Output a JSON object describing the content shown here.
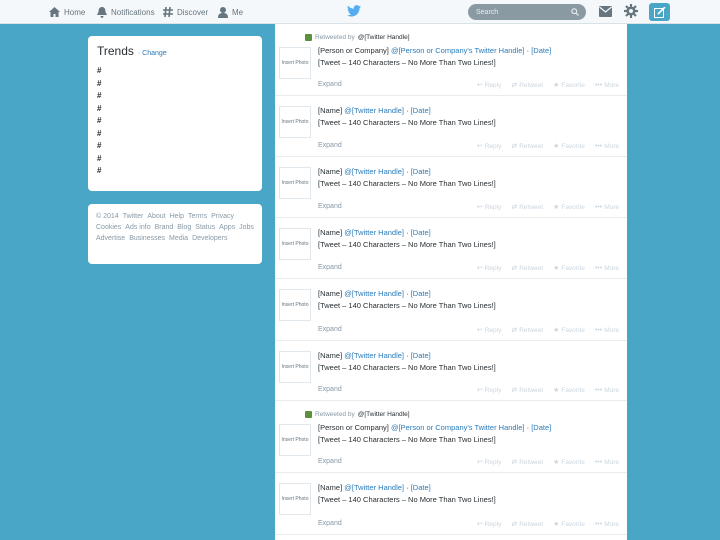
{
  "nav": {
    "home": "Home",
    "notifications": "Notifications",
    "discover": "Discover",
    "me": "Me",
    "search_placeholder": "Search"
  },
  "trends": {
    "title": "Trends",
    "change": "· Change",
    "items": [
      "#",
      "#",
      "#",
      "#",
      "#",
      "#",
      "#",
      "#",
      "#"
    ]
  },
  "footer": {
    "links": [
      "© 2014",
      "Twitter",
      "About",
      "Help",
      "Terms",
      "Privacy",
      "Cookies",
      "Ads info",
      "Brand",
      "Blog",
      "Status",
      "Apps",
      "Jobs",
      "Advertise",
      "Businesses",
      "Media",
      "Developers"
    ]
  },
  "tweet_labels": {
    "retweeted_by": "Retweeted by",
    "expand": "Expand",
    "reply": "Reply",
    "retweet": "Retweet",
    "favorite": "Favorite",
    "more": "More",
    "avatar": "Insert Photo"
  },
  "tweets": [
    {
      "retweet": true,
      "rt_handle": "@[Twitter Handle]",
      "name": "[Person or Company]",
      "handle": "@[Person or Company's Twitter Handle]",
      "sep": "·",
      "date": "[Date]",
      "text": "[Tweet – 140 Characters – No More Than Two Lines!]"
    },
    {
      "retweet": false,
      "rt_handle": "",
      "name": "[Name]",
      "handle": "@[Twitter Handle]",
      "sep": "·",
      "date": "[Date]",
      "text": "[Tweet – 140 Characters – No More Than Two Lines!]"
    },
    {
      "retweet": false,
      "rt_handle": "",
      "name": "[Name]",
      "handle": "@[Twitter Handle]",
      "sep": "·",
      "date": "[Date]",
      "text": "[Tweet – 140 Characters – No More Than Two Lines!]"
    },
    {
      "retweet": false,
      "rt_handle": "",
      "name": "[Name]",
      "handle": "@[Twitter Handle]",
      "sep": "·",
      "date": "[Date]",
      "text": "[Tweet – 140 Characters – No More Than Two Lines!]"
    },
    {
      "retweet": false,
      "rt_handle": "",
      "name": "[Name]",
      "handle": "@[Twitter Handle]",
      "sep": "·",
      "date": "[Date]",
      "text": "[Tweet – 140 Characters – No More Than Two Lines!]"
    },
    {
      "retweet": false,
      "rt_handle": "",
      "name": "[Name]",
      "handle": "@[Twitter Handle]",
      "sep": "·",
      "date": "[Date]",
      "text": "[Tweet – 140 Characters – No More Than Two Lines!]"
    },
    {
      "retweet": true,
      "rt_handle": "@[Twitter Handle]",
      "name": "[Person or Company]",
      "handle": "@[Person or Company's Twitter Handle]",
      "sep": "·",
      "date": "[Date]",
      "text": "[Tweet – 140 Characters – No More Than Two Lines!]"
    },
    {
      "retweet": false,
      "rt_handle": "",
      "name": "[Name]",
      "handle": "@[Twitter Handle]",
      "sep": "·",
      "date": "[Date]",
      "text": "[Tweet – 140 Characters – No More Than Two Lines!]"
    }
  ],
  "colors": {
    "background": "#4aa6c6",
    "link": "#2b7bb9",
    "text": "#292f33",
    "muted": "#8899a6",
    "action": "#ccd6dd"
  },
  "icons": [
    "home-icon",
    "bell-icon",
    "hashtag-icon",
    "person-icon",
    "twitter-bird-icon",
    "search-icon",
    "envelope-icon",
    "gear-icon",
    "compose-icon",
    "retweet-icon",
    "reply-icon",
    "star-icon",
    "more-icon"
  ]
}
